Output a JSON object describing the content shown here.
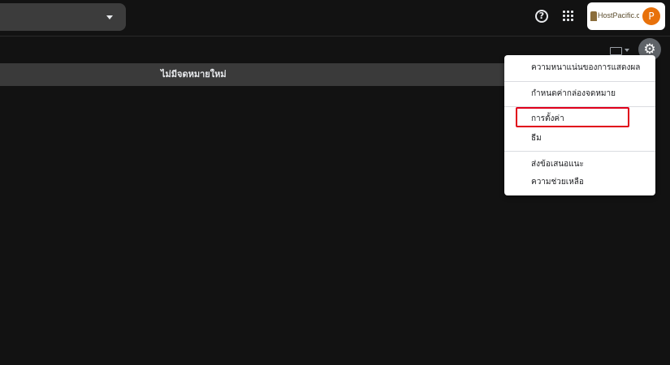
{
  "header": {
    "search_caret": "chevron-down-icon",
    "help_icon_glyph": "?",
    "apps_icon": "apps-grid-icon",
    "account": {
      "logo_text": "HostPacific.com",
      "avatar_letter": "P"
    }
  },
  "toolbar": {
    "keyboard_icon": "keyboard-icon",
    "settings_icon_glyph": "⚙"
  },
  "calendar_bar": {
    "message": "ไม่มีจดหมายใหม่"
  },
  "settings_menu": {
    "items": [
      {
        "label": "ความหนาแน่นของการแสดงผล"
      },
      {
        "label": "กำหนดค่ากล่องจดหมาย"
      },
      {
        "label": "การตั้งค่า"
      },
      {
        "label": "ธีม"
      },
      {
        "label": "ส่งข้อเสนอแนะ"
      },
      {
        "label": "ความช่วยเหลือ"
      }
    ],
    "highlight_color": "#e0001a"
  }
}
